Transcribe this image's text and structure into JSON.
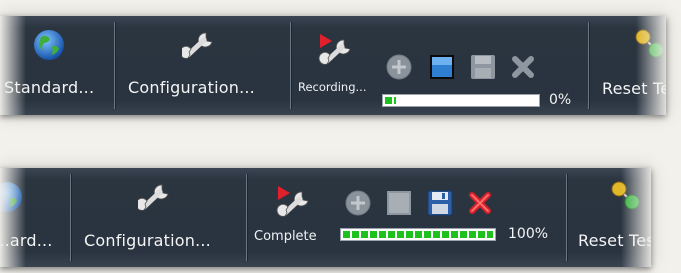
{
  "toolbar_recording": {
    "standards_label": "Standard...",
    "configuration_label": "Configuration...",
    "status_label": "Recording...",
    "progress": 0.07,
    "percent_text": "0%",
    "reset_label": "Reset Tes"
  },
  "toolbar_complete": {
    "standards_label": "...ard...",
    "configuration_label": "Configuration...",
    "status_label": "Complete",
    "progress": 1.0,
    "percent_text": "100%",
    "reset_label": "Reset Tes"
  },
  "colors": {
    "toolbar_bg": "#2a3440",
    "progress_green": "#1ec21e",
    "stop_blue": "#2e7fd1",
    "delete_red": "#d6202a"
  },
  "icons": {
    "standards": "globe-icon",
    "configuration": "wrench-icon",
    "record": "record-wrench-icon",
    "add": "add-circle-icon",
    "stop": "stop-icon",
    "save": "floppy-disk-icon",
    "delete": "delete-x-icon",
    "reset": "reset-nodes-icon"
  }
}
